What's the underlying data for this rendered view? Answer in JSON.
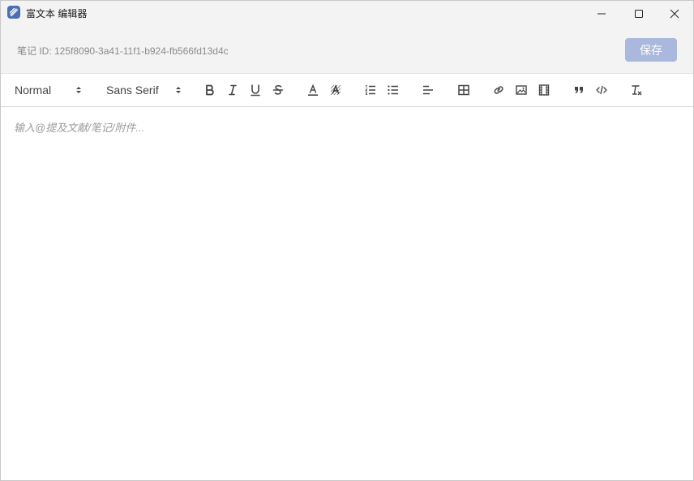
{
  "window": {
    "title": "富文本 编辑器",
    "controls": [
      "minimize-icon",
      "maximize-icon",
      "close-icon"
    ]
  },
  "header": {
    "note_id": "笔记 ID: 125f8090-3a41-11f1-b924-fb566fd13d4c",
    "save_label": "保存"
  },
  "toolbar": {
    "header_select": "Normal",
    "font_select": "Sans Serif",
    "buttons": [
      "bold-icon",
      "italic-icon",
      "underline-icon",
      "strike-icon",
      "text-color-icon",
      "background-color-icon",
      "ordered-list-icon",
      "bullet-list-icon",
      "align-icon",
      "table-icon",
      "link-icon",
      "image-icon",
      "video-icon",
      "blockquote-icon",
      "code-block-icon",
      "clear-format-icon"
    ]
  },
  "editor": {
    "placeholder": "输入@提及文献/笔记/附件..."
  },
  "colors": {
    "save_button": "#a9b8dc",
    "app_icon": "#4a6fb5",
    "titlebar": "#f3f3f3"
  }
}
